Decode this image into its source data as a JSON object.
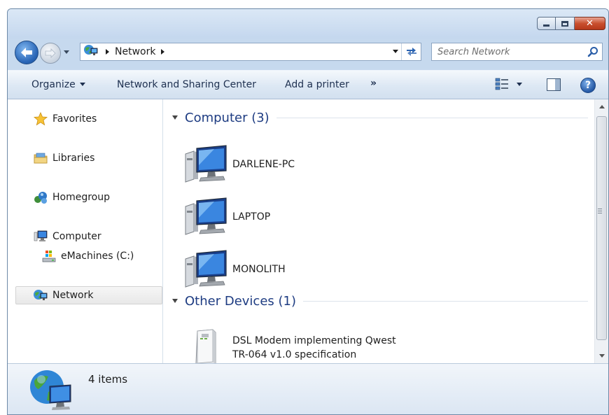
{
  "address": {
    "crumbs": [
      "Network"
    ],
    "icon": "network-icon"
  },
  "search": {
    "placeholder": "Search Network"
  },
  "toolbar": {
    "organize": "Organize",
    "network_sharing": "Network and Sharing Center",
    "add_printer": "Add a printer",
    "more": "»"
  },
  "nav": {
    "favorites": "Favorites",
    "libraries": "Libraries",
    "homegroup": "Homegroup",
    "computer": "Computer",
    "drive": "eMachines (C:)",
    "network": "Network"
  },
  "groups": [
    {
      "title": "Computer (3)",
      "items": [
        {
          "name": "DARLENE-PC",
          "icon": "computer-icon"
        },
        {
          "name": "LAPTOP",
          "icon": "computer-icon"
        },
        {
          "name": "MONOLITH",
          "icon": "computer-icon"
        }
      ]
    },
    {
      "title": "Other Devices (1)",
      "items": [
        {
          "name_line1": "DSL Modem implementing Qwest",
          "name_line2": "TR-064 v1.0 specification",
          "icon": "modem-icon"
        }
      ]
    }
  ],
  "details": {
    "count": "4 items"
  },
  "colors": {
    "accent": "#1e3c82",
    "chrome": "#c6d9ee",
    "close": "#c9502f"
  }
}
